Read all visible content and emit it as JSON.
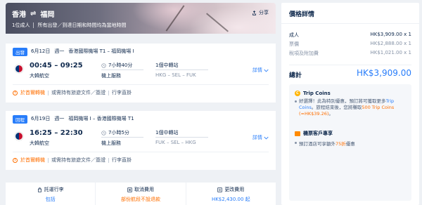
{
  "hero": {
    "origin": "香港",
    "swap_symbol": "⇌",
    "destination": "福岡",
    "passengers": "1位成人",
    "note": "所有出發／到達日期和時間均為當地時間",
    "share_label": "分享"
  },
  "flights": [
    {
      "tag": "出發",
      "date": "6月12日",
      "weekday": "週一",
      "route": "香港國際機場 T1 – 福岡機場 I",
      "time": "00:45 – 09:25",
      "carrier": "大韓航空",
      "duration": "7小時40分",
      "meal": "機上服務",
      "stops": "1個中轉站",
      "stop_codes": "HKG – SEL – FUK",
      "details_label": "詳情",
      "warn_label": "於首爾轉機",
      "note1": "或需持有旅遊文件／簽證",
      "note2": "行李直掛"
    },
    {
      "tag": "回程",
      "date": "6月19日",
      "weekday": "週一",
      "route": "福岡機場 I – 香港國際機場 T1",
      "time": "16:25 – 22:30",
      "carrier": "大韓航空",
      "duration": "7小時5分",
      "meal": "機上服務",
      "stops": "1個中轉站",
      "stop_codes": "FUK – SEL – HKG",
      "details_label": "詳情",
      "warn_label": "於首爾轉機",
      "note1": "或需持有旅遊文件／簽證",
      "note2": "行李直掛"
    }
  ],
  "services": [
    {
      "title": "託運行李",
      "value": "包括",
      "icon": "luggage-icon",
      "color": "blue"
    },
    {
      "title": "取消費用",
      "value": "部份航段不設退款",
      "icon": "cancel-icon",
      "color": "orange"
    },
    {
      "title": "更改費用",
      "value": "HK$2,430.00 起",
      "icon": "change-icon",
      "color": "blue"
    }
  ],
  "price": {
    "title": "價格詳情",
    "rows": [
      {
        "label": "成人",
        "value": "HK$3,909.00 x 1",
        "kind": "main"
      },
      {
        "label": "票價",
        "value": "HK$2,888.00 x 1",
        "kind": "sub"
      },
      {
        "label": "稅項及附加費",
        "value": "HK$1,021.00 x 1",
        "kind": "sub"
      }
    ],
    "total_label": "總計",
    "total_value": "HK$3,909.00"
  },
  "coins": {
    "title": "Trip Coins",
    "text_a": "好選擇！此為特別優惠，預訂將可獲取更多",
    "text_b": "Trip Coins",
    "text_c": "。旅程結束後，您將賺取",
    "text_d": "500 Trip Coins (≈HK$39.26)",
    "text_e": "。",
    "vip_title": "機票客戶專享",
    "vip_text_a": "預訂酒店可享額外",
    "vip_text_b": "75折",
    "vip_text_c": "優惠"
  },
  "colors": {
    "accent": "#287dfa",
    "warning": "#ff6f00",
    "text": "#0f294d"
  }
}
